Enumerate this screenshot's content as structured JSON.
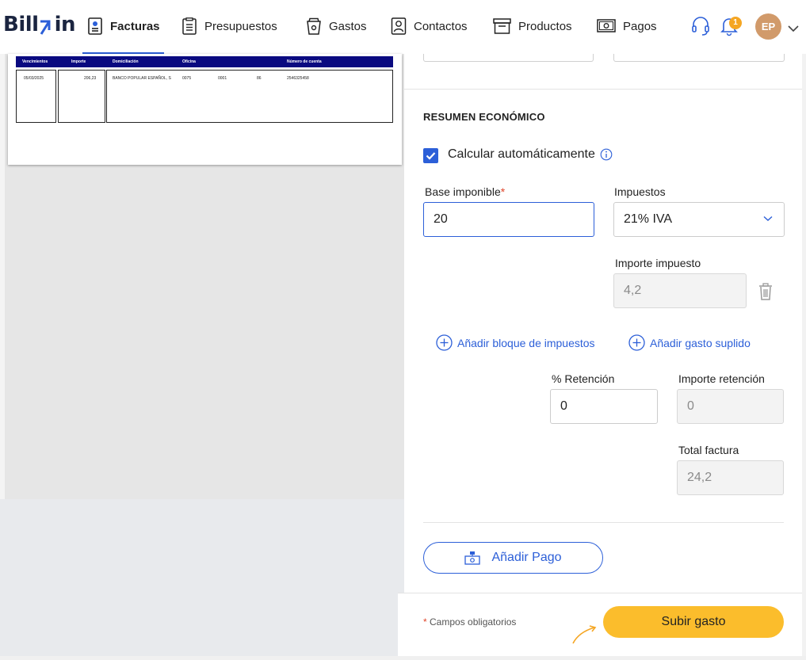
{
  "app": {
    "logo_text_left": "Bill",
    "logo_text_right": "in",
    "accent": "#2c5fd8",
    "submit_color": "#fbbd2c"
  },
  "nav": {
    "items": [
      {
        "label": "Facturas",
        "icon": "invoice-icon",
        "active": true
      },
      {
        "label": "Presupuestos",
        "icon": "clipboard-icon",
        "active": false
      },
      {
        "label": "Gastos",
        "icon": "cup-icon",
        "active": false
      },
      {
        "label": "Contactos",
        "icon": "contact-icon",
        "active": false
      },
      {
        "label": "Productos",
        "icon": "box-icon",
        "active": false
      },
      {
        "label": "Pagos",
        "icon": "money-icon",
        "active": false
      }
    ],
    "notification_count": "1",
    "avatar_initials": "EP"
  },
  "document": {
    "headers": [
      "Vencimientos",
      "Importe",
      "Domiciliación",
      "Oficina",
      "Número de cuenta"
    ],
    "row": [
      "05/03/2025",
      "206,23",
      "BANCO POPULAR ESPAÑOL, S",
      "0075",
      "0001",
      "86",
      "2546325458"
    ]
  },
  "form": {
    "section_title": "RESUMEN ECONÓMICO",
    "auto_calc_label": "Calcular automáticamente",
    "auto_calc_checked": true,
    "base_label": "Base imponible",
    "base_required_mark": "*",
    "base_value": "20",
    "tax_label": "Impuestos",
    "tax_value": "21% IVA",
    "tax_amount_label": "Importe impuesto",
    "tax_amount_value": "4,2",
    "add_tax_block": "Añadir bloque de impuestos",
    "add_supplied_expense": "Añadir gasto suplido",
    "retention_pct_label": "% Retención",
    "retention_pct_value": "0",
    "retention_amount_label": "Importe retención",
    "retention_amount_value": "0",
    "total_label": "Total factura",
    "total_value": "24,2",
    "add_payment": "Añadir Pago",
    "required_mark": "*",
    "required_note": "Campos obligatorios",
    "submit": "Subir gasto"
  }
}
